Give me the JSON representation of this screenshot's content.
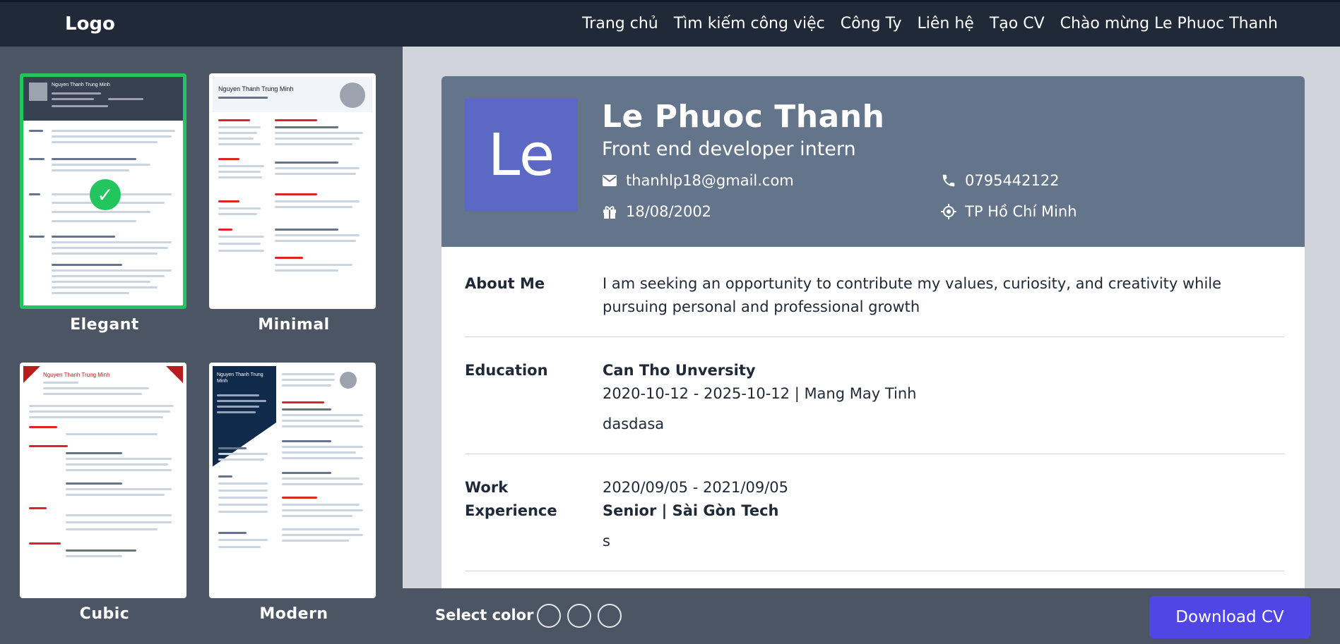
{
  "nav": {
    "logo": "Logo",
    "items": [
      "Trang chủ",
      "Tìm kiếm công việc",
      "Công Ty",
      "Liên hệ",
      "Tạo CV",
      "Chào mừng Le Phuoc Thanh"
    ]
  },
  "templates": [
    {
      "name": "Elegant",
      "selected": true,
      "sample_name": "Nguyen Thanh Trung Minh"
    },
    {
      "name": "Minimal",
      "selected": false,
      "sample_name": "Nguyen Thanh Trung Minh"
    },
    {
      "name": "Cubic",
      "selected": false,
      "sample_name": "Nguyen Thanh Trung Minh"
    },
    {
      "name": "Modern",
      "selected": false,
      "sample_name": "Nguyen Thanh Trung Minh"
    }
  ],
  "cv": {
    "avatar_text": "Le",
    "name": "Le Phuoc Thanh",
    "role": "Front end developer intern",
    "email": "thanhlp18@gmail.com",
    "phone": "0795442122",
    "birthday": "18/08/2002",
    "location": "TP Hồ Chí Minh",
    "about": {
      "label": "About Me",
      "line1": "I am seeking an opportunity to contribute my values, curiosity, and creativity while",
      "line2": "pursuing personal and professional growth"
    },
    "education": {
      "label": "Education",
      "school": "Can Tho Unversity",
      "period": "2020-10-12 - 2025-10-12 | Mang May Tinh",
      "note": "dasdasa"
    },
    "work": {
      "label_line1": "Work",
      "label_line2": "Experience",
      "period": "2020/09/05 - 2021/09/05",
      "title": "Senior | Sài Gòn Tech",
      "note": "s"
    }
  },
  "bottom": {
    "select_color_label": "Select color",
    "download_label": "Download CV"
  },
  "colors": {
    "topbar": "#1f2937",
    "panel": "#4b5563",
    "header": "#64748b",
    "avatar": "#5b68c4",
    "accent": "#4f46e5",
    "selected": "#22c55e"
  }
}
